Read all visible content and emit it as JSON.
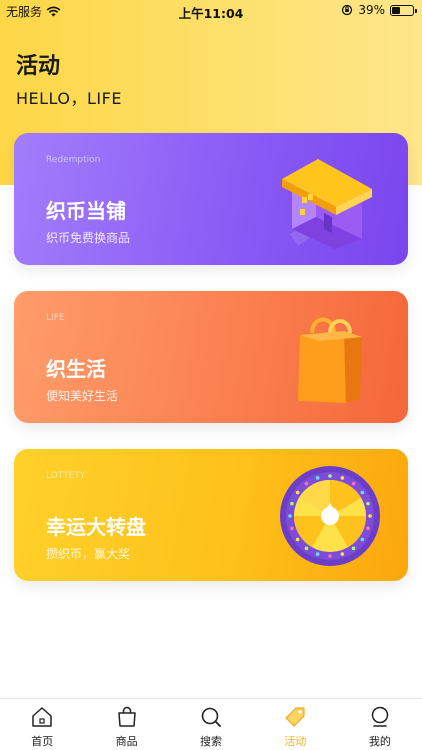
{
  "status_bar": {
    "carrier": "无服务",
    "time": "上午11:04",
    "battery": "39%",
    "battery_level": 0.39
  },
  "header": {
    "title": "活动",
    "subtitle": "HELLO，LIFE"
  },
  "cards": [
    {
      "tag": "Redemption",
      "title": "织币当铺",
      "desc": "织币免费换商品",
      "art": "house-icon"
    },
    {
      "tag": "LIFE",
      "title": "织生活",
      "desc": "便知美好生活",
      "art": "shopping-bag-icon"
    },
    {
      "tag": "LOTTETY",
      "title": "幸运大转盘",
      "desc": "攒织币，赢大奖",
      "art": "prize-wheel-icon"
    }
  ],
  "tabbar": {
    "items": [
      {
        "label": "首页",
        "icon": "home-icon",
        "active": false
      },
      {
        "label": "商品",
        "icon": "bag-icon",
        "active": false
      },
      {
        "label": "搜索",
        "icon": "search-icon",
        "active": false
      },
      {
        "label": "活动",
        "icon": "tag-icon",
        "active": true
      },
      {
        "label": "我的",
        "icon": "profile-icon",
        "active": false
      }
    ]
  },
  "colors": {
    "header_yellow": "#fdd746",
    "card_purple": "#8a5cf5",
    "card_orange": "#fb8050",
    "card_yellow": "#fec11b",
    "active_tab": "#f5b323"
  }
}
